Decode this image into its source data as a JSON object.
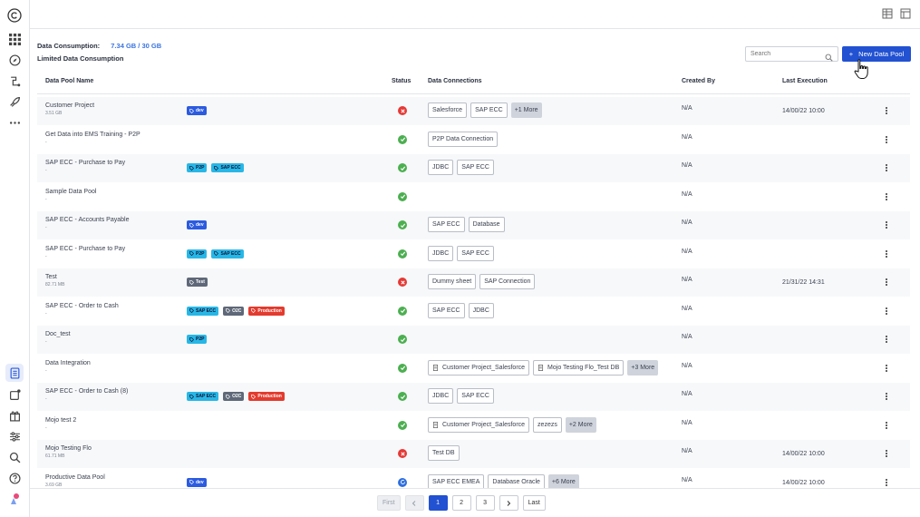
{
  "consumption": {
    "label": "Data Consumption:",
    "value": "7.34 GB / 30 GB",
    "limited_label": "Limited Data Consumption"
  },
  "search": {
    "placeholder": "Search"
  },
  "new_button": {
    "icon": "+",
    "label": "New Data Pool"
  },
  "columns": {
    "name": "Data Pool Name",
    "status": "Status",
    "connections": "Data Connections",
    "created_by": "Created By",
    "last_execution": "Last Execution"
  },
  "rows": [
    {
      "name": "Customer Project",
      "size": "3.51 GB",
      "tags": [
        {
          "label": "dev",
          "color": "blue"
        }
      ],
      "status": "error",
      "connections": [
        {
          "label": "Salesforce"
        },
        {
          "label": "SAP ECC"
        }
      ],
      "more": "+1 More",
      "created_by": "N/A",
      "last_execution": "14/00/22 10:00"
    },
    {
      "name": "Get Data into EMS Training - P2P",
      "size": "-",
      "tags": [],
      "status": "success",
      "connections": [
        {
          "label": "P2P Data Connection"
        }
      ],
      "more": "",
      "created_by": "N/A",
      "last_execution": ""
    },
    {
      "name": "SAP ECC - Purchase to Pay",
      "size": "-",
      "tags": [
        {
          "label": "P2P",
          "color": "cyan"
        },
        {
          "label": "SAP ECC",
          "color": "cyan"
        }
      ],
      "status": "success",
      "connections": [
        {
          "label": "JDBC"
        },
        {
          "label": "SAP ECC"
        }
      ],
      "more": "",
      "created_by": "N/A",
      "last_execution": ""
    },
    {
      "name": "Sample Data Pool",
      "size": "-",
      "tags": [],
      "status": "success",
      "connections": [],
      "more": "",
      "created_by": "N/A",
      "last_execution": ""
    },
    {
      "name": "SAP ECC - Accounts Payable",
      "size": "-",
      "tags": [
        {
          "label": "dev",
          "color": "blue"
        }
      ],
      "status": "success",
      "connections": [
        {
          "label": "SAP ECC"
        },
        {
          "label": "Database"
        }
      ],
      "more": "",
      "created_by": "N/A",
      "last_execution": ""
    },
    {
      "name": "SAP ECC - Purchase to Pay",
      "size": "-",
      "tags": [
        {
          "label": "P2P",
          "color": "cyan"
        },
        {
          "label": "SAP ECC",
          "color": "cyan"
        }
      ],
      "status": "success",
      "connections": [
        {
          "label": "JDBC"
        },
        {
          "label": "SAP ECC"
        }
      ],
      "more": "",
      "created_by": "N/A",
      "last_execution": ""
    },
    {
      "name": "Test",
      "size": "82.71 MB",
      "tags": [
        {
          "label": "Test",
          "color": "gray"
        }
      ],
      "status": "error",
      "connections": [
        {
          "label": "Dummy sheet"
        },
        {
          "label": "SAP Connection"
        }
      ],
      "more": "",
      "created_by": "N/A",
      "last_execution": "21/31/22 14:31"
    },
    {
      "name": "SAP ECC - Order to Cash",
      "size": "-",
      "tags": [
        {
          "label": "SAP ECC",
          "color": "cyan"
        },
        {
          "label": "O2C",
          "color": "gray"
        },
        {
          "label": "Production",
          "color": "red"
        }
      ],
      "status": "success",
      "connections": [
        {
          "label": "SAP ECC"
        },
        {
          "label": "JDBC"
        }
      ],
      "more": "",
      "created_by": "N/A",
      "last_execution": ""
    },
    {
      "name": "Doc_test",
      "size": "-",
      "tags": [
        {
          "label": "P2P",
          "color": "cyan"
        }
      ],
      "status": "success",
      "connections": [],
      "more": "",
      "created_by": "N/A",
      "last_execution": ""
    },
    {
      "name": "Data Integration",
      "size": "-",
      "tags": [],
      "status": "success",
      "connections": [
        {
          "label": "Customer Project_Salesforce",
          "icon": true
        },
        {
          "label": "Mojo Testing Flo_Test DB",
          "icon": true
        }
      ],
      "more": "+3 More",
      "created_by": "N/A",
      "last_execution": ""
    },
    {
      "name": "SAP ECC - Order to Cash (8)",
      "size": "-",
      "tags": [
        {
          "label": "SAP ECC",
          "color": "cyan"
        },
        {
          "label": "O2C",
          "color": "gray"
        },
        {
          "label": "Production",
          "color": "red"
        }
      ],
      "status": "success",
      "connections": [
        {
          "label": "JDBC"
        },
        {
          "label": "SAP ECC"
        }
      ],
      "more": "",
      "created_by": "N/A",
      "last_execution": ""
    },
    {
      "name": "Mojo test 2",
      "size": "-",
      "tags": [],
      "status": "success",
      "connections": [
        {
          "label": "Customer Project_Salesforce",
          "icon": true
        },
        {
          "label": "zezezs"
        }
      ],
      "more": "+2 More",
      "created_by": "N/A",
      "last_execution": ""
    },
    {
      "name": "Mojo Testing Flo",
      "size": "61.71 MB",
      "tags": [],
      "status": "error",
      "connections": [
        {
          "label": "Test DB"
        }
      ],
      "more": "",
      "created_by": "N/A",
      "last_execution": "14/00/22 10:00"
    },
    {
      "name": "Productive Data Pool",
      "size": "3.69 GB",
      "tags": [
        {
          "label": "dev",
          "color": "blue"
        }
      ],
      "status": "running",
      "connections": [
        {
          "label": "SAP ECC EMEA"
        },
        {
          "label": "Database Oracle"
        }
      ],
      "more": "+6 More",
      "created_by": "N/A",
      "last_execution": "14/00/22 10:00"
    }
  ],
  "pagination": {
    "first": "First",
    "pages": [
      "1",
      "2",
      "3"
    ],
    "current": "1",
    "last": "Last"
  },
  "colors": {
    "primary": "#2251d1",
    "success": "#4caf50",
    "error": "#e53935",
    "running": "#2f6fe0",
    "tag_blue": "#2c5be0",
    "tag_cyan": "#27b7e6",
    "tag_gray": "#5f6878",
    "tag_red": "#e33b2e"
  },
  "icons": {
    "rail_top": [
      "celonis-logo-icon",
      "apps-grid-icon",
      "compass-icon",
      "flow-icon",
      "rocket-icon",
      "more-icon"
    ],
    "rail_bottom": [
      "data-pools-icon",
      "tasks-icon",
      "gift-icon",
      "sliders-icon",
      "search-icon",
      "help-icon",
      "user-avatar-icon"
    ],
    "top_right": [
      "table-view-icon",
      "layout-icon"
    ]
  }
}
